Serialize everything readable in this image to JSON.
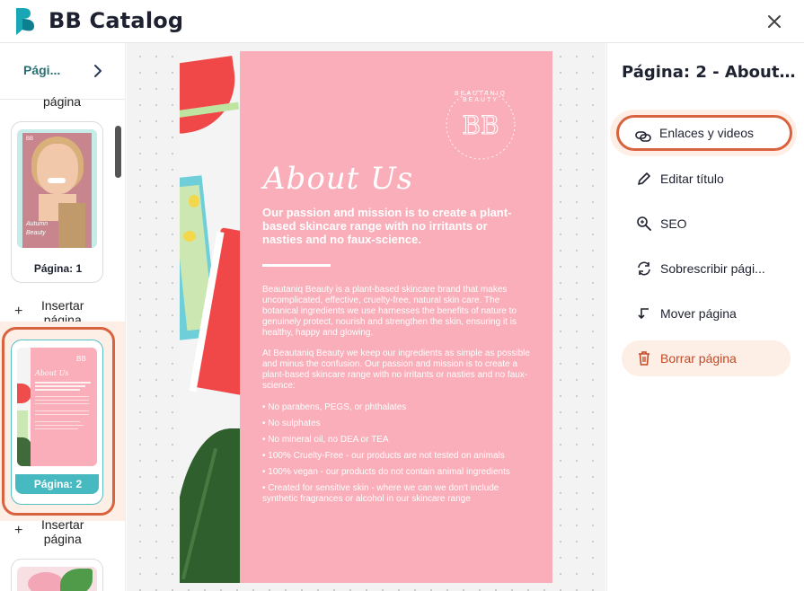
{
  "app": {
    "title": "BB Catalog",
    "accent_color": "#2a6f73",
    "highlight_color": "#d9623f"
  },
  "header": {
    "logo_icon": "bb-logo-icon",
    "close_icon": "close-icon"
  },
  "left_panel": {
    "tab_label": "Pági...",
    "insert_label_top_partial": "página",
    "insert_page_label_line1": "Insertar",
    "insert_page_label_line2": "página",
    "pages": [
      {
        "label": "Página: 1",
        "caption_name": "Autumn",
        "caption_brand": "Beauty"
      },
      {
        "label": "Página: 2",
        "selected": true
      }
    ]
  },
  "document": {
    "brand_monogram": "BB",
    "brand_ring_text": "BEAUTANIQ BEAUTY",
    "about_title": "About Us",
    "intro": "Our passion and mission is to create a plant-based skincare range with no irritants or nasties and no faux-science.",
    "paragraph1": "Beautaniq Beauty is a plant-based skincare brand that makes uncomplicated, effective, cruelty-free, natural skin care. The botanical ingredients we use harnesses the benefits of nature to genuinely protect, nourish and strengthen the skin, ensuring it is healthy, happy and glowing.",
    "paragraph2": "At Beautaniq Beauty we keep our ingredients as simple as possible and minus the confusion. Our passion and mission is to create a plant-based skincare range with no irritants or nasties and no faux-science:",
    "bullets": [
      "• No parabens, PEGS, or phthalates",
      "• No sulphates",
      "• No mineral oil, no DEA or TEA",
      "• 100% Cruelty-Free - our products are not tested on animals",
      "• 100% vegan - our products do not contain animal ingredients",
      "• Created for sensitive skin - where we can we don't include synthetic fragrances or alcohol in our skincare range"
    ]
  },
  "right_panel": {
    "page_title": "Página: 2 - About Us",
    "actions": [
      {
        "label": "Enlaces y videos",
        "icon": "link-video-icon",
        "highlighted": true
      },
      {
        "label": "Editar título",
        "icon": "pencil-icon"
      },
      {
        "label": "SEO",
        "icon": "search-zoom-icon"
      },
      {
        "label": "Sobrescribir pági...",
        "icon": "refresh-icon"
      },
      {
        "label": "Mover página",
        "icon": "move-arrow-icon"
      },
      {
        "label": "Borrar página",
        "icon": "trash-icon",
        "danger": true
      }
    ]
  }
}
